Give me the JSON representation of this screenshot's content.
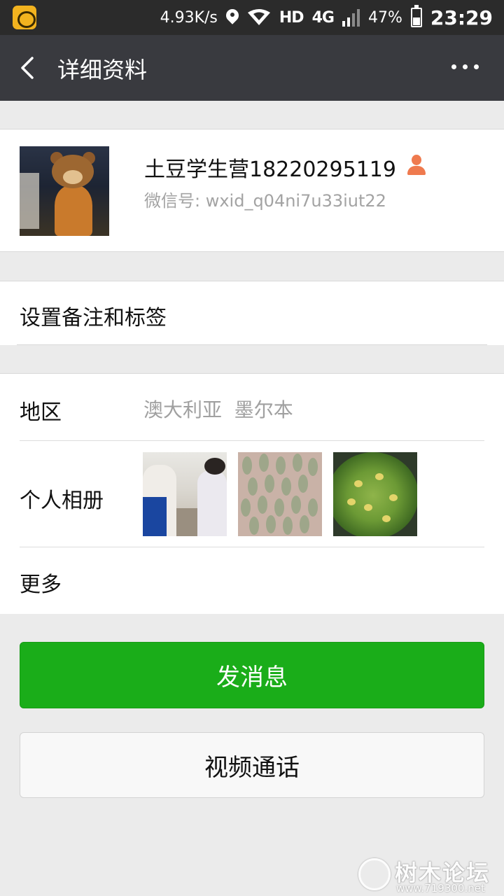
{
  "status_bar": {
    "speed": "4.93K/s",
    "network_hd": "HD",
    "network_type": "4G",
    "battery": "47%",
    "time": "23:29"
  },
  "nav": {
    "title": "详细资料"
  },
  "profile": {
    "name": "土豆学生营18220295119",
    "wechat_id": "微信号: wxid_q04ni7u33iut22"
  },
  "remark": {
    "label": "设置备注和标签"
  },
  "info": {
    "region_label": "地区",
    "region_value": "澳大利亚  墨尔本",
    "album_label": "个人相册",
    "more_label": "更多"
  },
  "actions": {
    "send_message": "发消息",
    "video_call": "视频通话"
  },
  "watermark": {
    "text": "树木论坛",
    "url": "www.719300.net"
  },
  "colors": {
    "primary_green": "#1aad19",
    "nav_bg": "#393a3f"
  }
}
